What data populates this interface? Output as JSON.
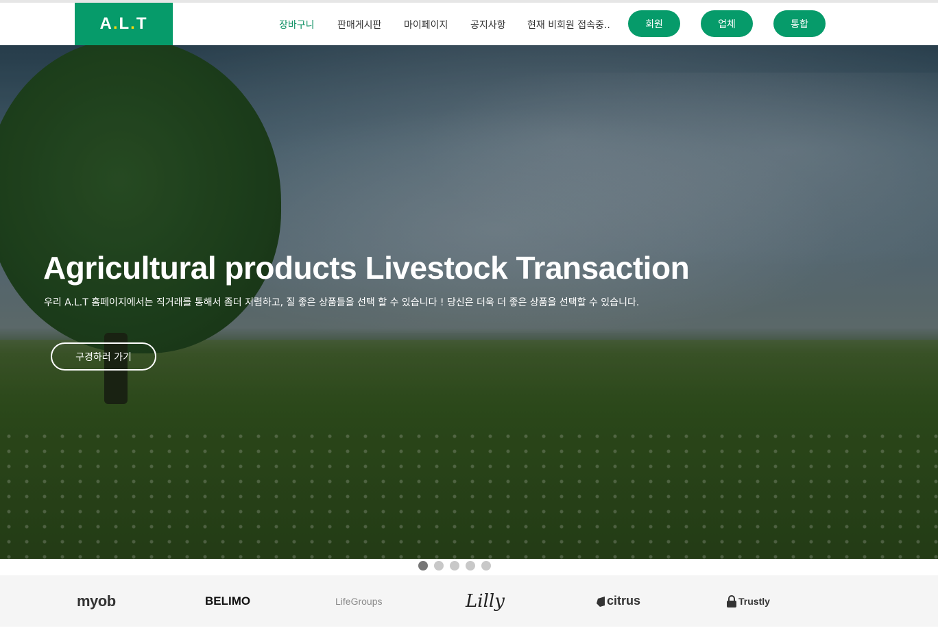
{
  "header": {
    "logo": {
      "a": "A",
      "dot1": ".",
      "l": "L",
      "dot2": ".",
      "t": "T"
    },
    "nav": [
      "장바구니",
      "판매게시판",
      "마이페이지",
      "공지사항",
      "현재 비회원 접속중.."
    ],
    "buttons": [
      "회원",
      "업체",
      "통합"
    ],
    "accent_color": "#069b6a"
  },
  "hero": {
    "title": "Agricultural products Livestock Transaction",
    "subtitle": "우리 A.L.T 홈페이지에서는 직거래를 통해서 좀더 저렴하고, 질 좋은 상품들을 선택 할 수 있습니다 ! 당신은 더욱 더 좋은 상품을 선택할 수 있습니다.",
    "cta": "구경하러 가기"
  },
  "carousel": {
    "count": 5,
    "active": 1
  },
  "partners": [
    "myob",
    "BELIMO",
    "LifeGroups",
    "Lilly",
    "citrus",
    "Trustly"
  ]
}
